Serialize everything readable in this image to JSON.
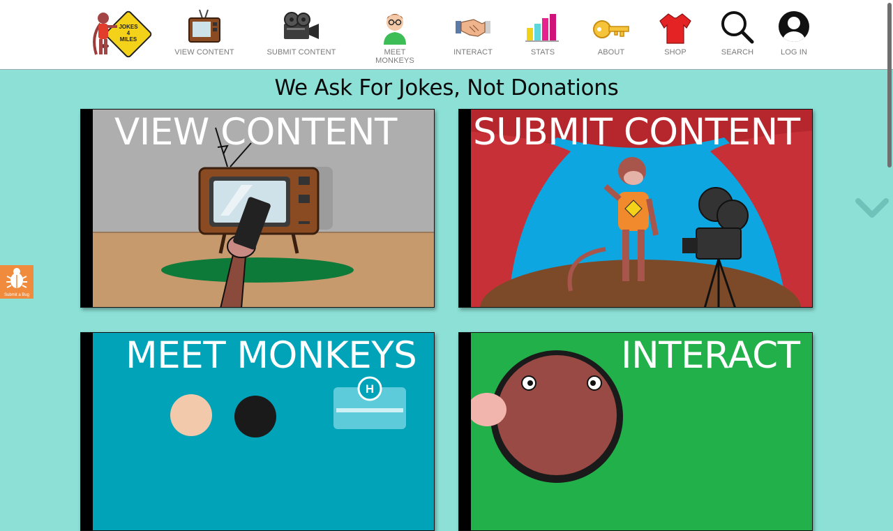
{
  "logo": {
    "line1": "JOKES",
    "line2": "4",
    "line3": "MILES"
  },
  "nav": [
    {
      "label": "VIEW CONTENT",
      "icon": "tv-icon"
    },
    {
      "label": "SUBMIT CONTENT",
      "icon": "movie-camera-icon"
    },
    {
      "label": "MEET MONKEYS",
      "icon": "person-icon"
    },
    {
      "label": "INTERACT",
      "icon": "handshake-icon"
    },
    {
      "label": "STATS",
      "icon": "bar-chart-icon"
    },
    {
      "label": "ABOUT",
      "icon": "key-icon"
    },
    {
      "label": "SHOP",
      "icon": "tshirt-icon"
    },
    {
      "label": "SEARCH",
      "icon": "search-icon"
    },
    {
      "label": "LOG IN",
      "icon": "user-avatar-icon"
    }
  ],
  "headline": "We Ask For Jokes, Not Donations",
  "tiles": {
    "view": {
      "title": "VIEW CONTENT",
      "bg": "#aeaeae"
    },
    "submit": {
      "title": "SUBMIT CONTENT",
      "bg": "#b5272d"
    },
    "meet": {
      "title": "MEET MONKEYS",
      "bg": "#00a3b8"
    },
    "interact": {
      "title": "INTERACT",
      "bg": "#22b04a"
    }
  },
  "bug_tab": {
    "label": "Submit a Bug"
  },
  "colors": {
    "page_bg": "#8ce0d6",
    "nav_text": "#7a7a7a",
    "bug_tab": "#f08a3c"
  }
}
